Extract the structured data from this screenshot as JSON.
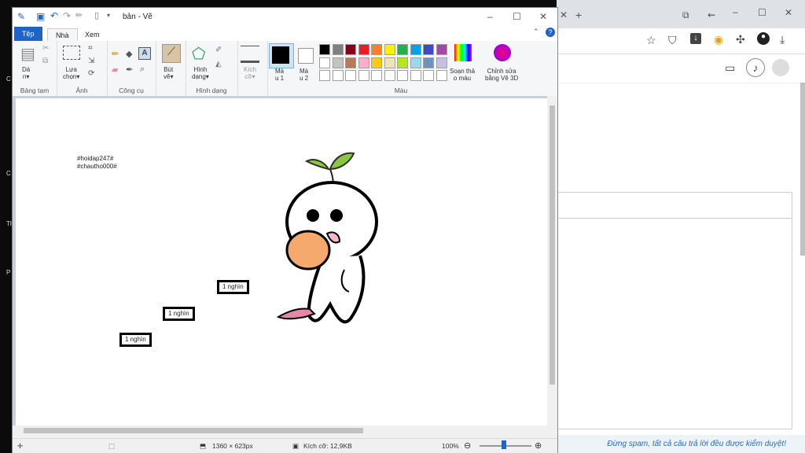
{
  "paint": {
    "title": "bản - Vẽ",
    "tabs": [
      "Tệp",
      "Nhà",
      "Xem"
    ],
    "groups": {
      "clipboard": {
        "label": "Bảng tạm",
        "paste_label": "Dá\nn▾"
      },
      "image": {
        "label": "Ảnh",
        "select_label": "Lựa\nchọn▾"
      },
      "tools": {
        "label": "Công cụ"
      },
      "brush": {
        "label": "Bút\nvẽ▾"
      },
      "shapes": {
        "label": "Hình dạng",
        "shapes_label": "Hình\ndạng▾"
      },
      "size": {
        "label": "Kích\ncỡ▾"
      },
      "colors": {
        "label": "Màu",
        "color1_label": "Mà\nu 1",
        "color2_label": "Mà\nu 2",
        "edit_colors_label": "Soạn thả\no màu",
        "paint3d_label": "Chỉnh sửa\nbằng Vẽ 3D",
        "row1": [
          "#000000",
          "#7f7f7f",
          "#880015",
          "#ed1c24",
          "#ff7f27",
          "#fff200",
          "#22b14c",
          "#00a2e8",
          "#3f48cc",
          "#a349a4"
        ],
        "row2": [
          "#ffffff",
          "#c3c3c3",
          "#b97a57",
          "#ffaec9",
          "#ffc90e",
          "#efe4b0",
          "#b5e61d",
          "#99d9ea",
          "#7092be",
          "#c8bfe7"
        ]
      }
    },
    "canvas": {
      "hashtag1": "#hoidap247#",
      "hashtag2": "#chautho000#",
      "label1": "1 nghìn",
      "label2": "1 nghìn",
      "label3": "1 nghìn"
    },
    "status": {
      "dimensions": "1360 × 623px",
      "file_size": "Kích cỡ: 12,9KB",
      "zoom": "100%"
    }
  },
  "browser": {
    "footer_text": "Đừng spam, tất cả câu trả lời đều được kiểm duyệt!"
  }
}
